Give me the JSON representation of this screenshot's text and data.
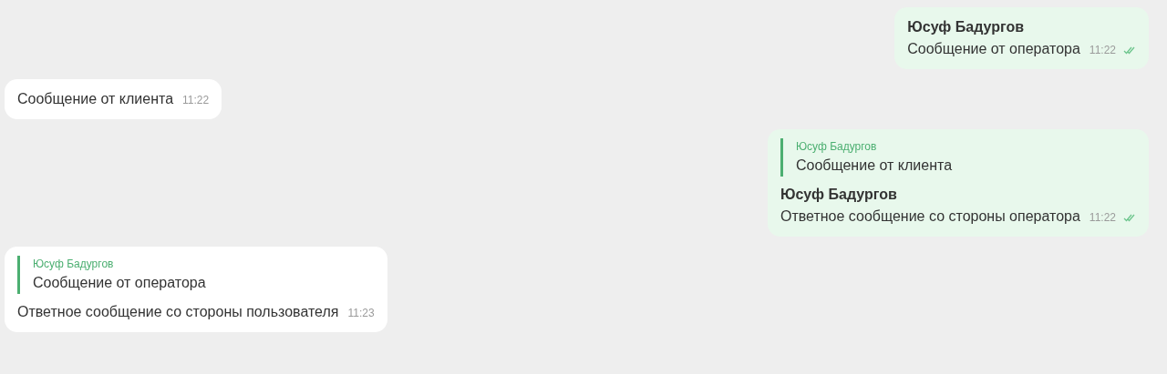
{
  "messages": [
    {
      "kind": "outgoing",
      "author": "Юсуф Бадургов",
      "text": "Сообщение от оператора",
      "time": "11:22",
      "read": true
    },
    {
      "kind": "incoming",
      "text": "Сообщение от клиента",
      "time": "11:22"
    },
    {
      "kind": "outgoing",
      "reply": {
        "author": "Юсуф Бадургов",
        "text": "Сообщение от клиента"
      },
      "author": "Юсуф Бадургов",
      "text": "Ответное сообщение со стороны оператора",
      "time": "11:22",
      "read": true
    },
    {
      "kind": "incoming",
      "reply": {
        "author": "Юсуф Бадургов",
        "text": "Сообщение от оператора"
      },
      "text": "Ответное сообщение со стороны пользователя",
      "time": "11:23"
    }
  ]
}
